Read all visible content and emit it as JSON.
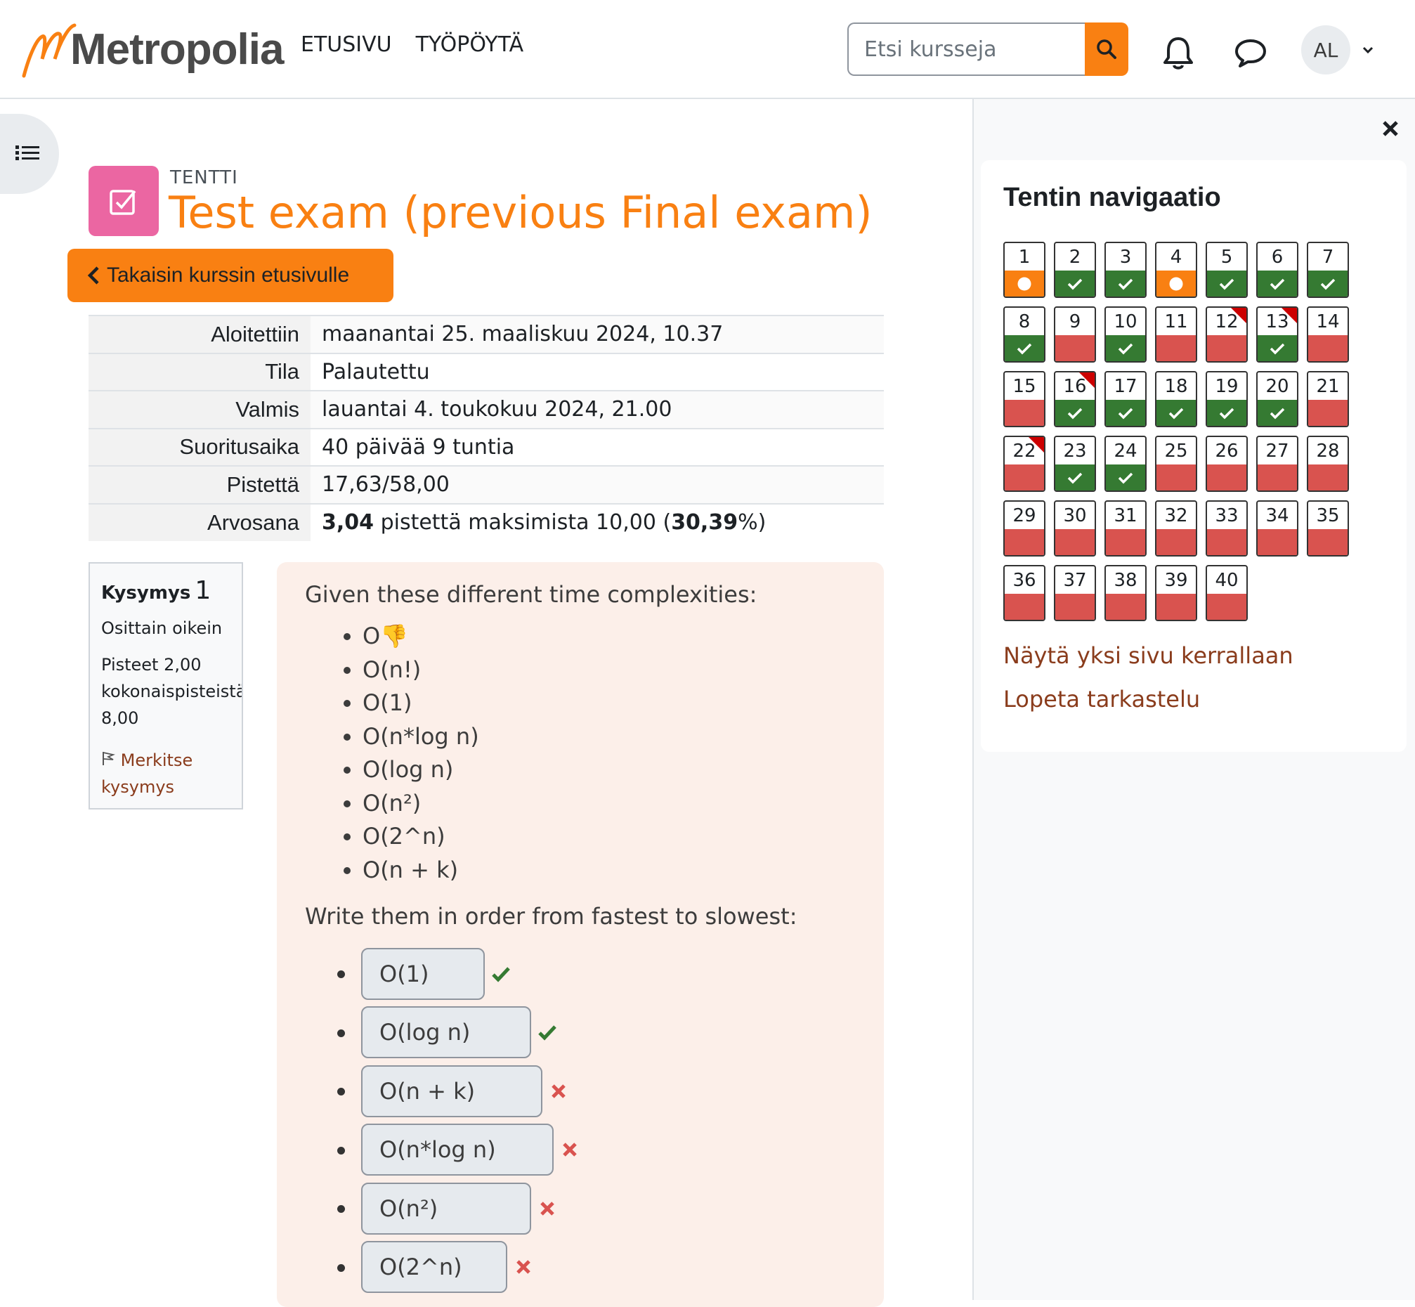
{
  "brand": {
    "name": "Metropolia"
  },
  "nav": {
    "home": "ETUSIVU",
    "dashboard": "TYÖPÖYTÄ"
  },
  "search": {
    "placeholder": "Etsi kursseja"
  },
  "user": {
    "initials": "AL"
  },
  "activity": {
    "pretitle": "TENTTI",
    "title": "Test exam (previous Final exam)",
    "icon_color": "#eb66a2"
  },
  "back_button": "Takaisin kurssin etusivulle",
  "summary": {
    "rows": [
      {
        "label": "Aloitettiin",
        "value": "maanantai 25. maaliskuu 2024, 10.37"
      },
      {
        "label": "Tila",
        "value": "Palautettu"
      },
      {
        "label": "Valmis",
        "value": "lauantai 4. toukokuu 2024, 21.00"
      },
      {
        "label": "Suoritusaika",
        "value": "40 päivää 9 tuntia"
      },
      {
        "label": "Pistettä",
        "value": "17,63/58,00"
      }
    ],
    "grade": {
      "label": "Arvosana",
      "score": "3,04",
      "mid": " pistettä maksimista 10,00 (",
      "percent": "30,39",
      "end": "%)"
    }
  },
  "question": {
    "label": "Kysymys",
    "number": "1",
    "state": "Osittain oikein",
    "points_l1": "Pisteet 2,00",
    "points_l2": "kokonaispisteistä",
    "points_l3": "8,00",
    "flag_l1": "Merkitse",
    "flag_l2": "kysymys",
    "intro": "Given these different time complexities:",
    "options": [
      "O👎",
      "O(n!)",
      "O(1)",
      "O(n*log n)",
      "O(log n)",
      "O(n²)",
      "O(2^n)",
      "O(n + k)"
    ],
    "prompt": "Write them in order from fastest to slowest:",
    "answers": [
      {
        "text": "O(1)",
        "result": "correct"
      },
      {
        "text": "O(log n)",
        "result": "correct"
      },
      {
        "text": "O(n + k)",
        "result": "incorrect"
      },
      {
        "text": "O(n*log n)",
        "result": "incorrect"
      },
      {
        "text": "O(n²)",
        "result": "incorrect"
      },
      {
        "text": "O(2^n)",
        "result": "incorrect"
      }
    ]
  },
  "navigation": {
    "title": "Tentin navigaatio",
    "states": [
      "partial",
      "correct",
      "correct",
      "partial",
      "correct",
      "correct",
      "correct",
      "correct",
      "wrong",
      "correct",
      "wrong",
      "wrong",
      "correct",
      "wrong",
      "wrong",
      "correct",
      "correct",
      "correct",
      "correct",
      "correct",
      "wrong",
      "wrong",
      "correct",
      "correct",
      "wrong",
      "wrong",
      "wrong",
      "wrong",
      "wrong",
      "wrong",
      "wrong",
      "wrong",
      "wrong",
      "wrong",
      "wrong",
      "wrong",
      "wrong",
      "wrong",
      "wrong",
      "wrong"
    ],
    "flagged": [
      12,
      13,
      16,
      22
    ],
    "link_one_page": "Näytä yksi sivu kerrallaan",
    "link_finish": "Lopeta tarkastelu"
  },
  "colors": {
    "accent": "#f98012",
    "correct": "#357a32",
    "wrong": "#d9534f",
    "link": "#8a3c1c"
  }
}
